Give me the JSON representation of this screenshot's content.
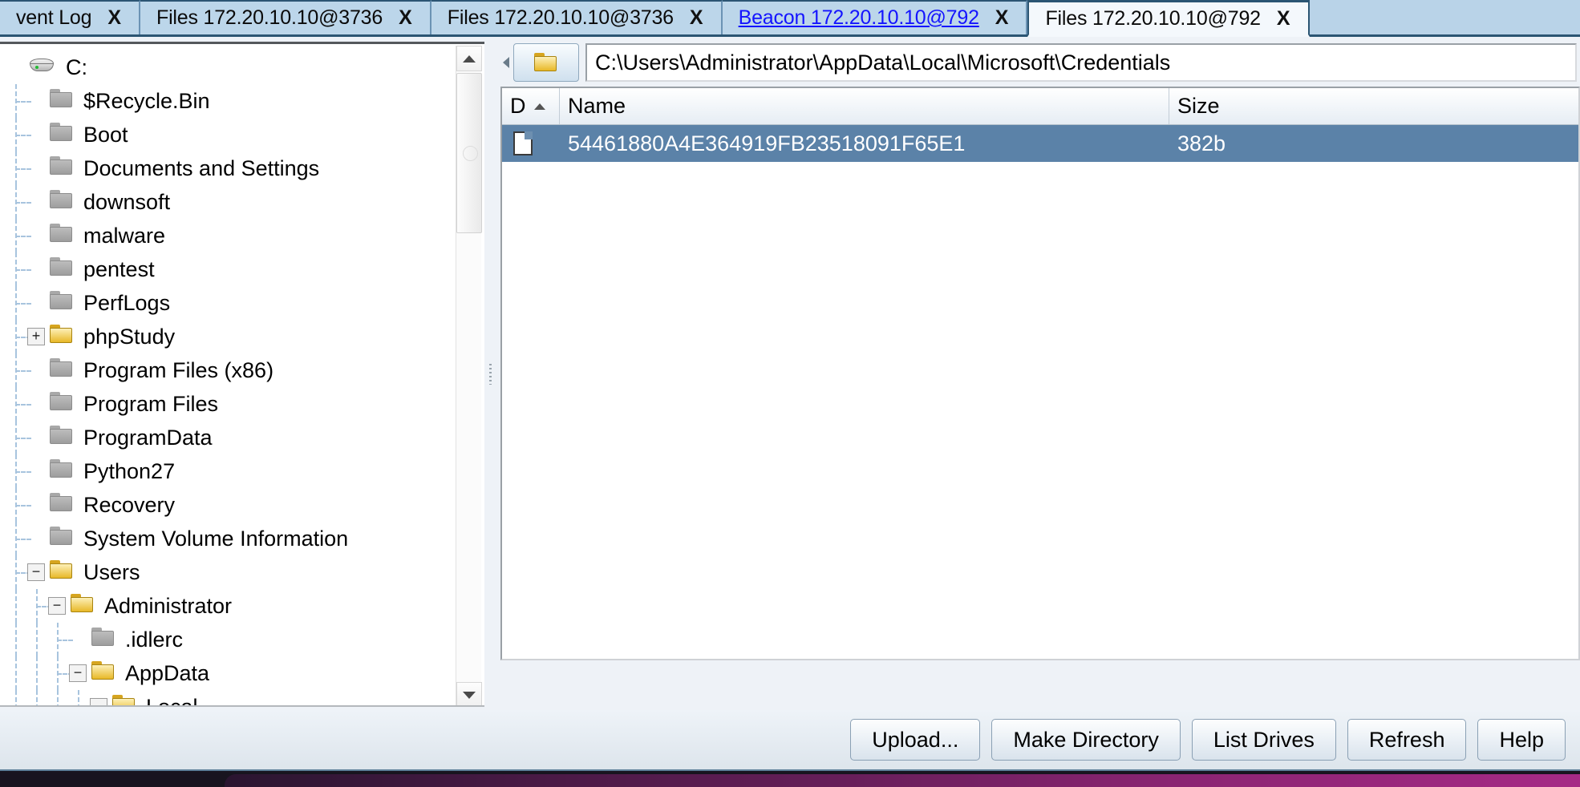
{
  "window": {
    "title": "Files 172.20.10.10@792"
  },
  "tabs": [
    {
      "label": "vent Log",
      "close": "X",
      "active": false,
      "style": "normal"
    },
    {
      "label": "Files 172.20.10.10@3736",
      "close": "X",
      "active": false,
      "style": "normal"
    },
    {
      "label": "Files 172.20.10.10@3736",
      "close": "X",
      "active": false,
      "style": "normal"
    },
    {
      "label": "Beacon 172.20.10.10@792",
      "close": "X",
      "active": false,
      "style": "beacon"
    },
    {
      "label": "Files 172.20.10.10@792",
      "close": "X",
      "active": true,
      "style": "normal"
    }
  ],
  "tree": {
    "items": [
      {
        "label": "C:",
        "depth": 0,
        "icon": "drive-icon",
        "toggle": "",
        "expanded": true
      },
      {
        "label": "$Recycle.Bin",
        "depth": 1,
        "icon": "folder-gray-icon",
        "toggle": "",
        "expanded": false
      },
      {
        "label": "Boot",
        "depth": 1,
        "icon": "folder-gray-icon",
        "toggle": "",
        "expanded": false
      },
      {
        "label": "Documents and Settings",
        "depth": 1,
        "icon": "folder-gray-icon",
        "toggle": "",
        "expanded": false
      },
      {
        "label": "downsoft",
        "depth": 1,
        "icon": "folder-gray-icon",
        "toggle": "",
        "expanded": false
      },
      {
        "label": "malware",
        "depth": 1,
        "icon": "folder-gray-icon",
        "toggle": "",
        "expanded": false
      },
      {
        "label": "pentest",
        "depth": 1,
        "icon": "folder-gray-icon",
        "toggle": "",
        "expanded": false
      },
      {
        "label": "PerfLogs",
        "depth": 1,
        "icon": "folder-gray-icon",
        "toggle": "",
        "expanded": false
      },
      {
        "label": "phpStudy",
        "depth": 1,
        "icon": "folder-gold-icon",
        "toggle": "+",
        "expanded": false
      },
      {
        "label": "Program Files (x86)",
        "depth": 1,
        "icon": "folder-gray-icon",
        "toggle": "",
        "expanded": false
      },
      {
        "label": "Program Files",
        "depth": 1,
        "icon": "folder-gray-icon",
        "toggle": "",
        "expanded": false
      },
      {
        "label": "ProgramData",
        "depth": 1,
        "icon": "folder-gray-icon",
        "toggle": "",
        "expanded": false
      },
      {
        "label": "Python27",
        "depth": 1,
        "icon": "folder-gray-icon",
        "toggle": "",
        "expanded": false
      },
      {
        "label": "Recovery",
        "depth": 1,
        "icon": "folder-gray-icon",
        "toggle": "",
        "expanded": false
      },
      {
        "label": "System Volume Information",
        "depth": 1,
        "icon": "folder-gray-icon",
        "toggle": "",
        "expanded": false
      },
      {
        "label": "Users",
        "depth": 1,
        "icon": "folder-gold-icon",
        "toggle": "−",
        "expanded": true
      },
      {
        "label": "Administrator",
        "depth": 2,
        "icon": "folder-gold-icon",
        "toggle": "−",
        "expanded": true
      },
      {
        "label": ".idlerc",
        "depth": 3,
        "icon": "folder-gray-icon",
        "toggle": "",
        "expanded": false
      },
      {
        "label": "AppData",
        "depth": 3,
        "icon": "folder-gold-icon",
        "toggle": "−",
        "expanded": true
      },
      {
        "label": "Local",
        "depth": 4,
        "icon": "folder-gold-icon",
        "toggle": "−",
        "expanded": true
      }
    ]
  },
  "pathbar": {
    "path": "C:\\Users\\Administrator\\AppData\\Local\\Microsoft\\Credentials",
    "up_button_icon": "folder-up-icon",
    "collapse_icon": "triangle-left-icon"
  },
  "filetable": {
    "columns": [
      {
        "key": "d",
        "label": "D",
        "sorted": "asc"
      },
      {
        "key": "name",
        "label": "Name",
        "sorted": ""
      },
      {
        "key": "size",
        "label": "Size",
        "sorted": ""
      }
    ],
    "rows": [
      {
        "icon": "file-icon",
        "name": "54461880A4E364919FB23518091F65E1",
        "size": "382b",
        "selected": true
      }
    ]
  },
  "buttons": [
    {
      "label": "Upload..."
    },
    {
      "label": "Make Directory"
    },
    {
      "label": "List Drives"
    },
    {
      "label": "Refresh"
    },
    {
      "label": "Help"
    }
  ],
  "colors": {
    "tab_bar": "#b9d3e8",
    "tab_active": "#f4f8fc",
    "beacon_link": "#1414ff",
    "selection": "#5b82a8",
    "border_dark": "#2b5573",
    "folder_gold": "#e8b828",
    "folder_gray": "#a8a8a8"
  }
}
